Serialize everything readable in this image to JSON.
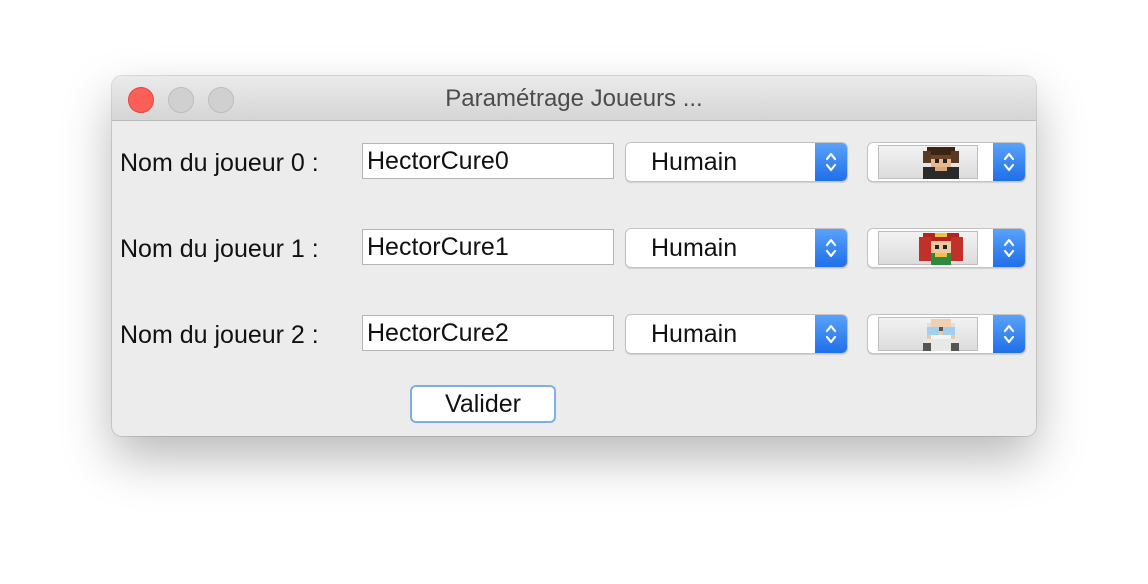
{
  "window": {
    "title": "Paramétrage Joueurs ..."
  },
  "players": [
    {
      "label": "Nom du joueur 0 :",
      "name": "HectorCure0",
      "type": "Humain",
      "avatar": "brown-haired-boy"
    },
    {
      "label": "Nom du joueur 1 :",
      "name": "HectorCure1",
      "type": "Humain",
      "avatar": "red-haired-girl"
    },
    {
      "label": "Nom du joueur 2 :",
      "name": "HectorCure2",
      "type": "Humain",
      "avatar": "bald-old-man-with-goggles"
    }
  ],
  "validate_label": "Valider",
  "colors": {
    "close": "#fc5f57",
    "stepper_accent": "#2c7cf0",
    "focus_ring": "#7eaee8"
  }
}
